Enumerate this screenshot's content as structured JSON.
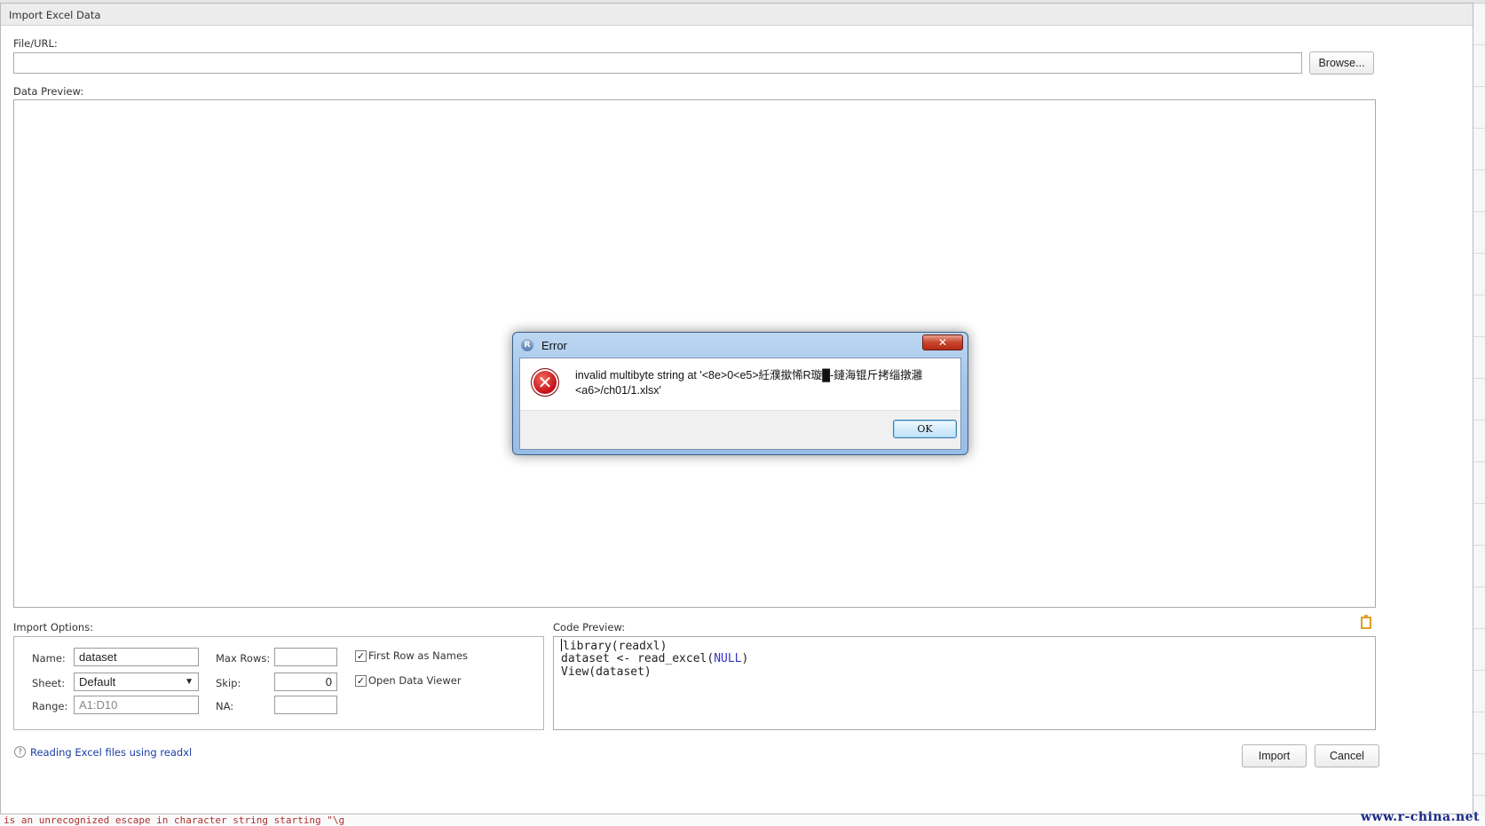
{
  "dialog": {
    "title": "Import Excel Data",
    "file_url_label": "File/URL:",
    "file_url_value": "",
    "browse_label": "Browse...",
    "data_preview_label": "Data Preview:"
  },
  "import_options": {
    "header": "Import Options:",
    "name_label": "Name:",
    "name_value": "dataset",
    "sheet_label": "Sheet:",
    "sheet_value": "Default",
    "range_label": "Range:",
    "range_placeholder": "A1:D10",
    "max_rows_label": "Max Rows:",
    "max_rows_value": "",
    "skip_label": "Skip:",
    "skip_value": "0",
    "na_label": "NA:",
    "na_value": "",
    "first_row_names_label": "First Row as Names",
    "first_row_names_checked": true,
    "open_viewer_label": "Open Data Viewer",
    "open_viewer_checked": true
  },
  "code_preview": {
    "header": "Code Preview:",
    "line1": "library(readxl)",
    "line2_prefix": "dataset <- read_excel(",
    "line2_null": "NULL",
    "line2_suffix": ")",
    "line3": "View(dataset)"
  },
  "footer": {
    "help_link": "Reading Excel files using readxl",
    "import_label": "Import",
    "cancel_label": "Cancel"
  },
  "error_modal": {
    "title": "Error",
    "message_line1": "invalid multibyte string at '<8e>0<e5>紝濮撳悕R璇█-鏈海锟斤拷缁撴灉",
    "message_line2": "<a6>/ch01/1.xlsx'",
    "ok_label": "OK"
  },
  "background": {
    "console_text": "is an unrecognized escape in character string starting \"\\g"
  },
  "watermark": "www.r-china.net",
  "colors": {
    "link": "#1a3fa6",
    "null_keyword": "#3333cc",
    "error_red": "#c8121a"
  }
}
